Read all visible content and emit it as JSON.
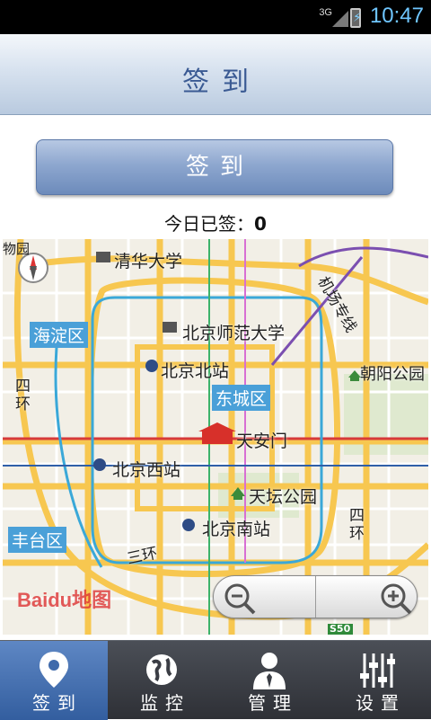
{
  "status_bar": {
    "network": "3G",
    "time": "10:47"
  },
  "header": {
    "title": "签到"
  },
  "checkin_button": {
    "label": "签到"
  },
  "today": {
    "label": "今日已签：",
    "count": "0"
  },
  "map": {
    "labels": {
      "tsinghua": "清华大学",
      "haidian": "海淀区",
      "bnu": "北京师范大学",
      "bj_north": "北京北站",
      "dongcheng": "东城区",
      "chaoyang_park": "朝阳公园",
      "tiananmen": "天安门",
      "bj_west": "北京西站",
      "tiantan": "天坛公园",
      "fengtai": "丰台区",
      "bj_south": "北京南站",
      "fourth_ring_left": "四环",
      "fourth_ring_right": "四环",
      "third_ring": "三环",
      "airport_express": "机场专线",
      "museum_fragment": "物园",
      "route_shield": "S50",
      "logo": "Baidu地图"
    }
  },
  "tabs": [
    {
      "label": "签到",
      "icon": "location-pin-icon",
      "active": true
    },
    {
      "label": "监控",
      "icon": "globe-icon",
      "active": false
    },
    {
      "label": "管理",
      "icon": "user-icon",
      "active": false
    },
    {
      "label": "设置",
      "icon": "sliders-icon",
      "active": false
    }
  ],
  "colors": {
    "accent": "#3a5a93",
    "tab_active": "#4a74b4",
    "tab_bg": "#3a3d44"
  }
}
